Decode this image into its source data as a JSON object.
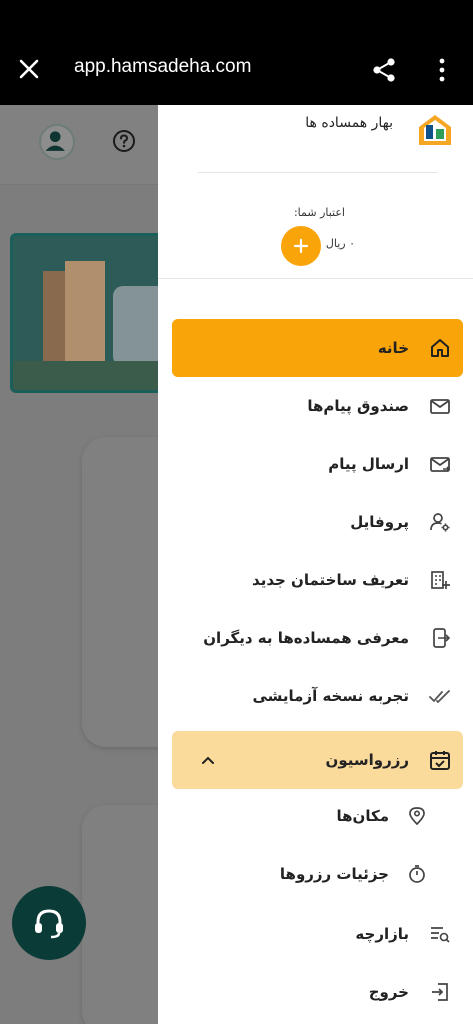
{
  "browser": {
    "url": "app.hamsadeha.com",
    "icons": {
      "close": "close-icon",
      "share": "share-icon",
      "more": "more-vert-icon"
    }
  },
  "drawer": {
    "brand_name": "بهار همساده ها",
    "credit_label": "اعتبار شما:",
    "credit_value": "۰ ریال",
    "accent_color": "#f9a408",
    "expanded_color": "#fbdb9c",
    "menu": [
      {
        "label": "خانه",
        "icon": "home-icon",
        "state": "active"
      },
      {
        "label": "صندوق پیام‌ها",
        "icon": "mail-icon"
      },
      {
        "label": "ارسال پیام",
        "icon": "send-mail-icon"
      },
      {
        "label": "پروفایل",
        "icon": "user-settings-icon"
      },
      {
        "label": "تعریف ساختمان جدید",
        "icon": "add-building-icon"
      },
      {
        "label": "معرفی همساده‌ها به دیگران",
        "icon": "share-device-icon"
      },
      {
        "label": "تجربه نسخه آزمایشی",
        "icon": "double-check-icon"
      },
      {
        "label": "رزرواسیون",
        "icon": "calendar-check-icon",
        "state": "expanded"
      }
    ],
    "submenu": [
      {
        "label": "مکان‌ها",
        "icon": "location-pin-icon"
      },
      {
        "label": "جزئیات رزروها",
        "icon": "timer-icon"
      }
    ],
    "bottom_menu": [
      {
        "label": "بازارچه",
        "icon": "search-list-icon"
      },
      {
        "label": "خروج",
        "icon": "logout-icon"
      }
    ]
  },
  "support_button": {
    "icon": "headset-icon",
    "color": "#0b3b37"
  }
}
